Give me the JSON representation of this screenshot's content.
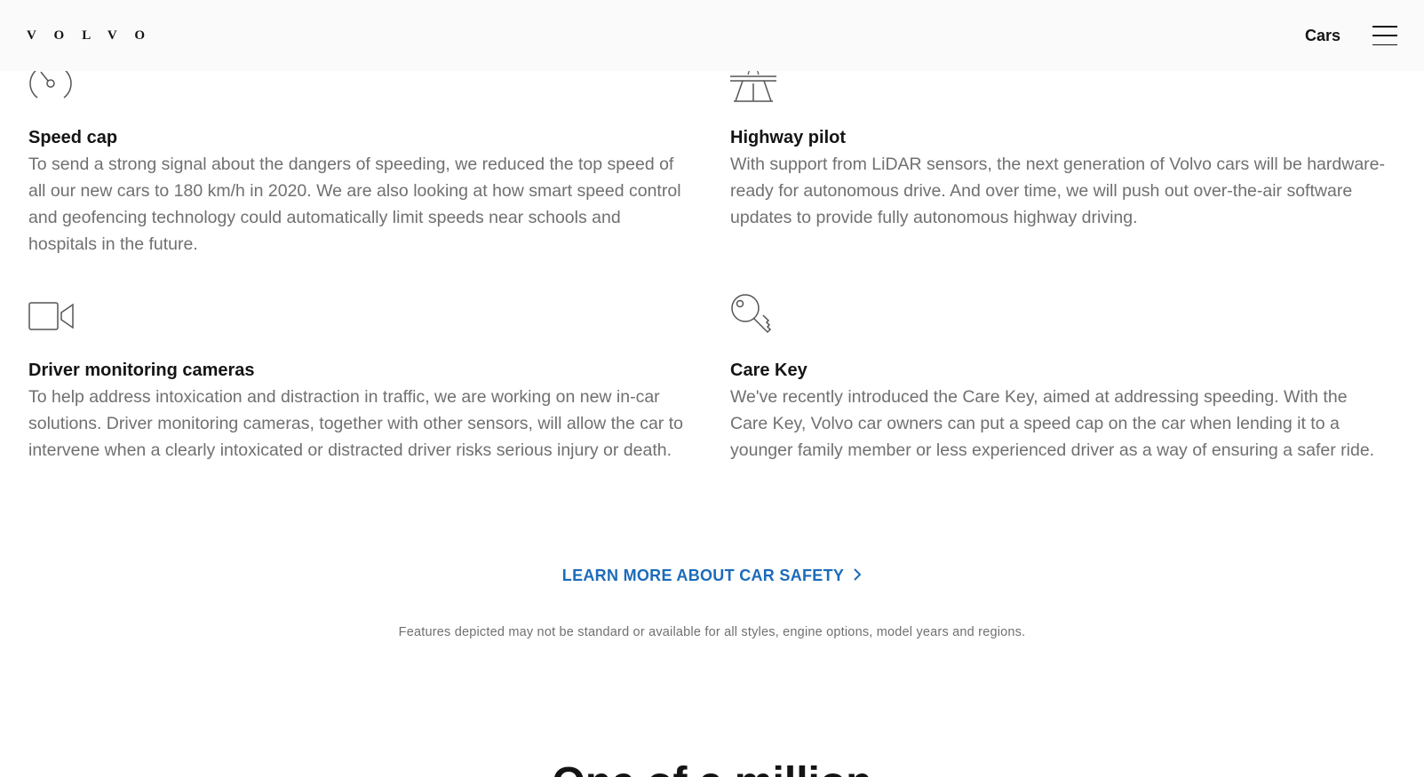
{
  "header": {
    "logo": "VOLVO",
    "nav_cars": "Cars",
    "menu_icon": "hamburger-menu-icon"
  },
  "features": {
    "speed_cap": {
      "icon": "speedometer-icon",
      "title": "Speed cap",
      "body": "To send a strong signal about the dangers of speeding, we reduced the top speed of all our new cars to 180 km/h in 2020. We are also looking at how smart speed control and geofencing technology could automatically limit speeds near schools and hospitals in the future."
    },
    "highway_pilot": {
      "icon": "highway-icon",
      "title": "Highway pilot",
      "body": "With support from LiDAR sensors, the next generation of Volvo cars will be hardware-ready for autonomous drive. And over time, we will push out over-the-air software updates to provide fully autonomous highway driving."
    },
    "driver_monitoring": {
      "icon": "camera-icon",
      "title": "Driver monitoring cameras",
      "body": "To help address intoxication and distraction in traffic, we are working on new in-car solutions. Driver monitoring cameras, together with other sensors, will allow the car to intervene when a clearly intoxicated or distracted driver risks serious injury or death."
    },
    "care_key": {
      "icon": "key-icon",
      "title": "Care Key",
      "body": "We've recently introduced the Care Key, aimed at addressing speeding. With the Care Key, Volvo car owners can put a speed cap on the car when lending it to a younger family member or less experienced driver as a way of ensuring a safer ride."
    }
  },
  "cta": {
    "label": "LEARN MORE ABOUT CAR SAFETY",
    "icon": "chevron-right-icon"
  },
  "disclaimer": "Features depicted may not be standard or available for all styles, engine options, model years and regions.",
  "next_section": {
    "heading": "One of a million"
  },
  "colors": {
    "accent_link": "#1c6bba",
    "body_text": "#707070",
    "heading_text": "#141414",
    "header_bg": "#fafafa"
  }
}
